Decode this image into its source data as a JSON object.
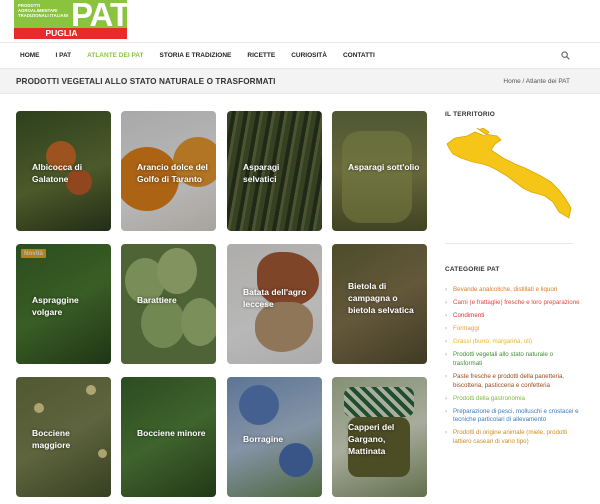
{
  "logo": {
    "subtitle": "PRODOTTI AGROALIMENTARI TRADIZIONALI ITALIANI",
    "brand": "PAT",
    "region": "PUGLIA"
  },
  "nav": {
    "items": [
      {
        "label": "HOME",
        "active": false
      },
      {
        "label": "I PAT",
        "active": false
      },
      {
        "label": "ATLANTE DEI PAT",
        "active": true
      },
      {
        "label": "STORIA E TRADIZIONE",
        "active": false
      },
      {
        "label": "RICETTE",
        "active": false
      },
      {
        "label": "CURIOSITÀ",
        "active": false
      },
      {
        "label": "CONTATTI",
        "active": false
      }
    ],
    "search_icon": "search-icon"
  },
  "page": {
    "title": "PRODOTTI VEGETALI ALLO STATO NATURALE O TRASFORMATI",
    "breadcrumb_home": "Home",
    "breadcrumb_sep": " / ",
    "breadcrumb_current": "Atlante dei PAT"
  },
  "products": [
    {
      "name": "Albicocca di Galatone",
      "badge": ""
    },
    {
      "name": "Arancio dolce del Golfo di Taranto",
      "badge": ""
    },
    {
      "name": "Asparagi selvatici",
      "badge": ""
    },
    {
      "name": "Asparagi sott'olio",
      "badge": ""
    },
    {
      "name": "Aspraggine volgare",
      "badge": "Novità"
    },
    {
      "name": "Barattiere",
      "badge": ""
    },
    {
      "name": "Batata dell'agro leccese",
      "badge": ""
    },
    {
      "name": "Bietola di campagna o bietola selvatica",
      "badge": ""
    },
    {
      "name": "Bocciene maggiore",
      "badge": ""
    },
    {
      "name": "Bocciene minore",
      "badge": ""
    },
    {
      "name": "Borragine",
      "badge": ""
    },
    {
      "name": "Capperi del Gargano, Mattinata",
      "badge": ""
    }
  ],
  "sidebar": {
    "territory_heading": "IL TERRITORIO",
    "categories_heading": "CATEGORIE PAT",
    "categories": [
      {
        "label": "Bevande analcoliche, distillati e liquori",
        "color": "#e07b25"
      },
      {
        "label": "Carni (e frattaglie) fresche e loro preparazione",
        "color": "#e2493d"
      },
      {
        "label": "Condimenti",
        "color": "#d8332f"
      },
      {
        "label": "Formaggi",
        "color": "#e8a02a"
      },
      {
        "label": "Grassi (burro, margarina, oli)",
        "color": "#f0b429"
      },
      {
        "label": "Prodotti vegetali allo stato naturale o trasformati",
        "color": "#3f8f35"
      },
      {
        "label": "Paste fresche e prodotti della panetteria, biscotteria, pasticceria e confetteria",
        "color": "#9a4b1f"
      },
      {
        "label": "Prodotti della gastronomia",
        "color": "#7dbb3f"
      },
      {
        "label": "Preparazione di pesci, molluschi e crostacei e tecniche particolari di allevamento",
        "color": "#3b7bbf"
      },
      {
        "label": "Prodotti di origine animale (miele, prodotti lattiero caseari di vario tipo)",
        "color": "#c9901e"
      }
    ]
  },
  "colors": {
    "accent_green": "#8ac43f",
    "logo_red": "#e52b2b",
    "map_yellow": "#f5c518",
    "badge_yellow": "#f4b62b"
  }
}
